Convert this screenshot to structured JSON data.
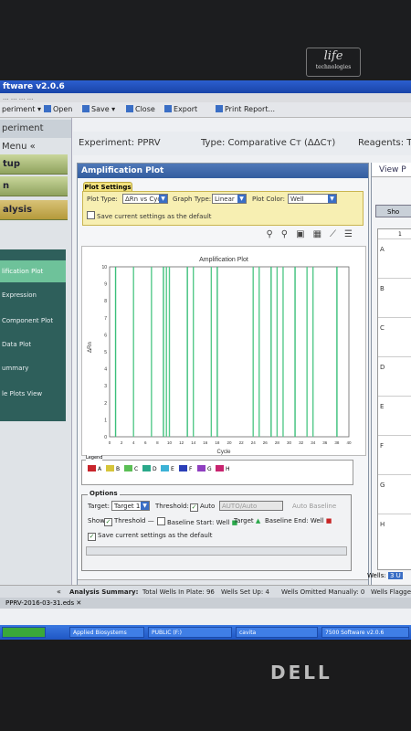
{
  "monitor": {
    "brand": "DELL",
    "logo_text": "life",
    "logo_sub": "technologies"
  },
  "window": {
    "title": "ftware v2.0.6",
    "menu": "...    ...    ...    ..."
  },
  "toolbar": {
    "experiment": "periment ▾",
    "open": "Open",
    "save": "Save ▾",
    "close": "Close",
    "export": "Export",
    "print": "Print Report..."
  },
  "nav": {
    "menu_title": "periment Menu «",
    "sections": [
      "tup",
      "n",
      "alysis"
    ],
    "items": [
      "lification Plot",
      "Expression",
      "Component Plot",
      "Data Plot",
      "ummary",
      "le Plots View"
    ]
  },
  "header": {
    "experiment": "Experiment:  PPRV",
    "type": "Type:  Comparative Cт (ΔΔCт)",
    "reagents": "Reagents:  T"
  },
  "panel": {
    "title": "Amplification Plot",
    "plot_settings_tab": "Plot Settings",
    "plot_type_label": "Plot Type:",
    "plot_type_value": "ΔRn vs Cycle",
    "graph_type_label": "Graph Type:",
    "graph_type_value": "Linear",
    "plot_color_label": "Plot Color:",
    "plot_color_value": "Well",
    "save_default": "Save current settings as the default"
  },
  "chart_data": {
    "type": "line",
    "title": "Amplification Plot",
    "xlabel": "Cycle",
    "ylabel": "ΔRn",
    "xlim": [
      0,
      40
    ],
    "ylim": [
      0,
      10
    ],
    "xticks": [
      0,
      2,
      4,
      6,
      8,
      10,
      12,
      14,
      16,
      18,
      20,
      22,
      24,
      26,
      28,
      30,
      32,
      34,
      36,
      38,
      40
    ],
    "yticks": [
      0,
      1,
      2,
      3,
      4,
      5,
      6,
      7,
      8,
      9,
      10
    ],
    "grid": false,
    "vertical_line_cycles": [
      1,
      4,
      7,
      9,
      9.5,
      10,
      13,
      14,
      17,
      18,
      24,
      25,
      27,
      28,
      29,
      31,
      33,
      34,
      38
    ]
  },
  "legend": {
    "title": "Legend",
    "items": [
      {
        "label": "A",
        "color": "#c8242b"
      },
      {
        "label": "B",
        "color": "#d6c53a"
      },
      {
        "label": "C",
        "color": "#5bbf55"
      },
      {
        "label": "D",
        "color": "#2aa88a"
      },
      {
        "label": "E",
        "color": "#3db2d6"
      },
      {
        "label": "F",
        "color": "#2b3fb8"
      },
      {
        "label": "G",
        "color": "#8f3fc0"
      },
      {
        "label": "H",
        "color": "#c8246f"
      }
    ]
  },
  "options": {
    "title": "Options",
    "target_label": "Target:",
    "target_value": "Target 1",
    "threshold_label": "Threshold:",
    "auto_label": "Auto",
    "threshold_value": "AUTO/Auto",
    "auto_baseline": "Auto Baseline",
    "show_label": "Show:",
    "threshold_chk": "Threshold",
    "baseline_start": "Baseline Start:",
    "well_label": "Well",
    "target_chk": "Target",
    "baseline_end": "Baseline End:",
    "well_label2": "Well",
    "save_default": "Save current settings as the default"
  },
  "right": {
    "view_label": "View P",
    "show_btn": "Sho",
    "row_labels": [
      "A",
      "B",
      "C",
      "D",
      "E",
      "F",
      "G",
      "H"
    ],
    "col_label": "1"
  },
  "status": {
    "summary": "Analysis Summary:",
    "total": "Total Wells In Plate: 96",
    "setup": "Wells Set Up: 4",
    "omitted": "Wells Omitted Manually: 0",
    "flagged": "Wells Flagge",
    "wells": "Wells:",
    "wells_count": "3 U"
  },
  "file_tab": "PPRV-2016-03-31.eds",
  "taskbar": [
    "Applied Biosystems",
    "PUBLIC (F:)",
    "cavita",
    "7500 Software v2.0.6"
  ]
}
